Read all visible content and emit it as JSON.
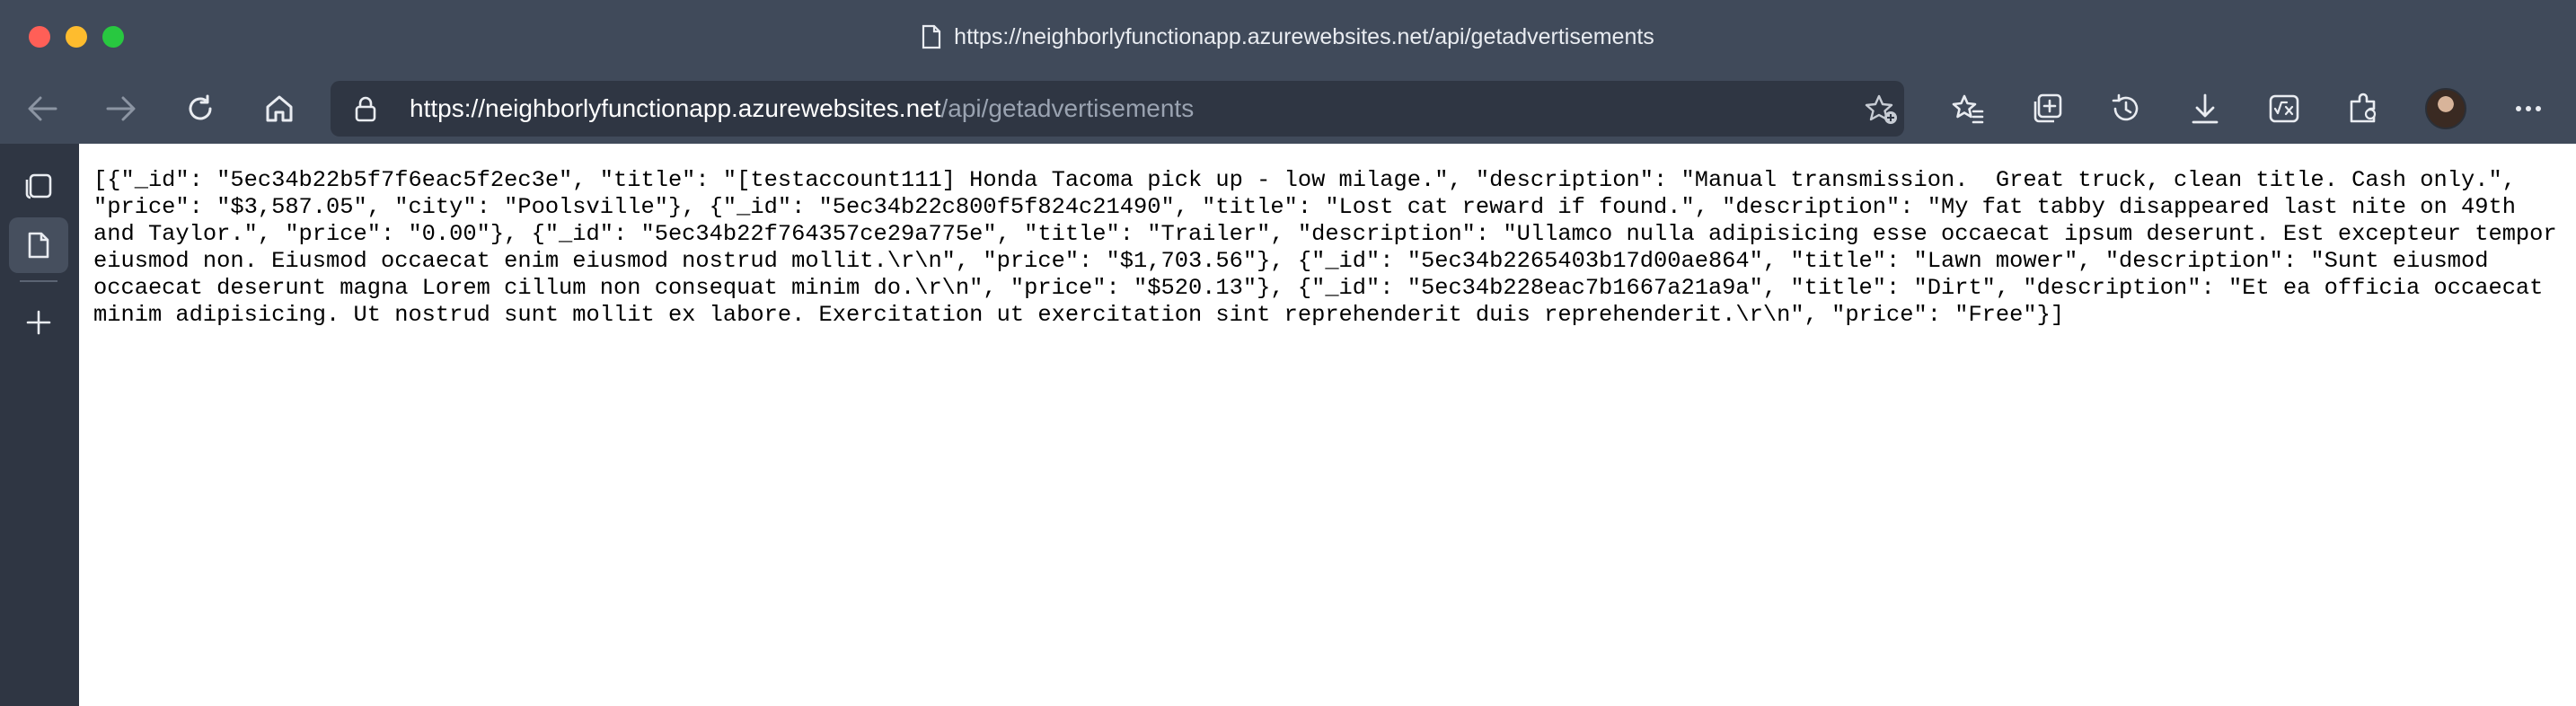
{
  "window": {
    "tab_title": "https://neighborlyfunctionapp.azurewebsites.net/api/getadvertisements"
  },
  "address_bar": {
    "url_host": "https://neighborlyfunctionapp.azurewebsites.net",
    "url_path": "/api/getadvertisements"
  },
  "toolbar_icons": [
    "back-icon",
    "forward-icon",
    "refresh-icon",
    "home-icon",
    "lock-icon",
    "add-favorite-icon",
    "favorites-icon",
    "collections-icon",
    "history-icon",
    "downloads-icon",
    "math-solver-icon",
    "extensions-icon",
    "profile-avatar",
    "more-icon"
  ],
  "sidebar_icons": [
    "tab-actions-icon",
    "vertical-tab-page-icon",
    "new-tab-icon"
  ],
  "colors": {
    "chrome": "#404a5a",
    "address_bar": "#2f3643",
    "sidebar": "#2f3643"
  },
  "content": {
    "raw_json": "[{\"_id\": \"5ec34b22b5f7f6eac5f2ec3e\", \"title\": \"[testaccount111] Honda Tacoma pick up - low milage.\", \"description\": \"Manual transmission.  Great truck, clean title. Cash only.\", \"price\": \"$3,587.05\", \"city\": \"Poolsville\"}, {\"_id\": \"5ec34b22c800f5f824c21490\", \"title\": \"Lost cat reward if found.\", \"description\": \"My fat tabby disappeared last nite on 49th and Taylor.\", \"price\": \"0.00\"}, {\"_id\": \"5ec34b22f764357ce29a775e\", \"title\": \"Trailer\", \"description\": \"Ullamco nulla adipisicing esse occaecat ipsum deserunt. Est excepteur tempor eiusmod non. Eiusmod occaecat enim eiusmod nostrud mollit.\\r\\n\", \"price\": \"$1,703.56\"}, {\"_id\": \"5ec34b2265403b17d00ae864\", \"title\": \"Lawn mower\", \"description\": \"Sunt eiusmod occaecat deserunt magna Lorem cillum non consequat minim do.\\r\\n\", \"price\": \"$520.13\"}, {\"_id\": \"5ec34b228eac7b1667a21a9a\", \"title\": \"Dirt\", \"description\": \"Et ea officia occaecat minim adipisicing. Ut nostrud sunt mollit ex labore. Exercitation ut exercitation sint reprehenderit duis reprehenderit.\\r\\n\", \"price\": \"Free\"}]"
  }
}
